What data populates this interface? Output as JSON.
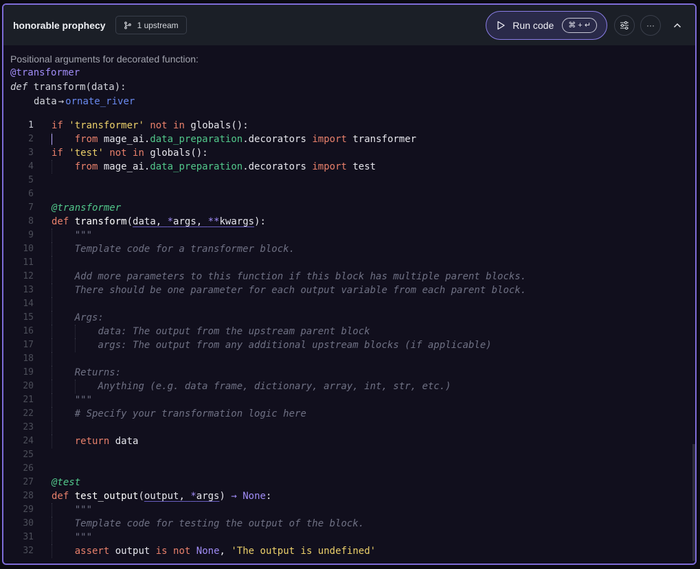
{
  "header": {
    "title": "honorable prophecy",
    "upstream_label": "1 upstream",
    "run_label": "Run code",
    "shortcut": "⌘ + ↵",
    "more_label": "···"
  },
  "info": {
    "label": "Positional arguments for decorated function:",
    "decorator": "@transformer",
    "def_kw": "def",
    "signature": "transform(data):",
    "arg_name": "data",
    "arrow": "→",
    "arg_source": "ornate_river"
  },
  "editor": {
    "active_line": 1,
    "lines": [
      "if 'transformer' not in globals():",
      "    from mage_ai.data_preparation.decorators import transformer",
      "if 'test' not in globals():",
      "    from mage_ai.data_preparation.decorators import test",
      "",
      "",
      "@transformer",
      "def transform(data, *args, **kwargs):",
      "    \"\"\"",
      "    Template code for a transformer block.",
      "",
      "    Add more parameters to this function if this block has multiple parent blocks.",
      "    There should be one parameter for each output variable from each parent block.",
      "",
      "    Args:",
      "        data: The output from the upstream parent block",
      "        args: The output from any additional upstream blocks (if applicable)",
      "",
      "    Returns:",
      "        Anything (e.g. data frame, dictionary, array, int, str, etc.)",
      "    \"\"\"",
      "    # Specify your transformation logic here",
      "",
      "    return data",
      "",
      "",
      "@test",
      "def test_output(output, *args) -> None:",
      "    \"\"\"",
      "    Template code for testing the output of the block.",
      "    \"\"\"",
      "    assert output is not None, 'The output is undefined'"
    ]
  }
}
